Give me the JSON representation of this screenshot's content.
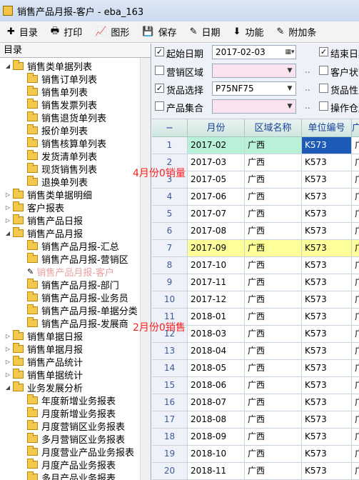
{
  "window": {
    "title": "销售产品月报-客户 - eba_163"
  },
  "toolbar": {
    "items": [
      {
        "label": "目录",
        "icon": "plus-icon"
      },
      {
        "label": "打印",
        "icon": "printer-icon"
      },
      {
        "label": "图形",
        "icon": "chart-icon"
      },
      {
        "label": "保存",
        "icon": "save-icon"
      },
      {
        "label": "日期",
        "icon": "wand-icon"
      },
      {
        "label": "功能",
        "icon": "down-arrow-icon"
      },
      {
        "label": "附加条",
        "icon": "wand-icon"
      }
    ]
  },
  "tree": {
    "header": "目录",
    "items": [
      {
        "label": "销售类单据列表",
        "level": 0,
        "expanded": true
      },
      {
        "label": "销售订单列表",
        "level": 1
      },
      {
        "label": "销售单列表",
        "level": 1
      },
      {
        "label": "销售发票列表",
        "level": 1
      },
      {
        "label": "销售退货单列表",
        "level": 1
      },
      {
        "label": "报价单列表",
        "level": 1
      },
      {
        "label": "销售核算单列表",
        "level": 1
      },
      {
        "label": "发货清单列表",
        "level": 1
      },
      {
        "label": "现货销售列表",
        "level": 1
      },
      {
        "label": "退换单列表",
        "level": 1
      },
      {
        "label": "销售类单据明细",
        "level": 0,
        "expanded": false
      },
      {
        "label": "客户报表",
        "level": 0,
        "expanded": false
      },
      {
        "label": "销售产品日报",
        "level": 0,
        "expanded": false
      },
      {
        "label": "销售产品月报",
        "level": 0,
        "expanded": true
      },
      {
        "label": "销售产品月报-汇总",
        "level": 1
      },
      {
        "label": "销售产品月报-营销区",
        "level": 1
      },
      {
        "label": "销售产品月报-客户",
        "level": 1,
        "selected": true
      },
      {
        "label": "销售产品月报-部门",
        "level": 1
      },
      {
        "label": "销售产品月报-业务员",
        "level": 1
      },
      {
        "label": "销售产品月报-单据分类",
        "level": 1
      },
      {
        "label": "销售产品月报-发展商",
        "level": 1
      },
      {
        "label": "销售单据日报",
        "level": 0,
        "expanded": false
      },
      {
        "label": "销售单据月报",
        "level": 0,
        "expanded": false
      },
      {
        "label": "销售产品统计",
        "level": 0,
        "expanded": false
      },
      {
        "label": "销售单据统计",
        "level": 0,
        "expanded": false
      },
      {
        "label": "业务发展分析",
        "level": 0,
        "expanded": true
      },
      {
        "label": "年度新增业务报表",
        "level": 1
      },
      {
        "label": "月度新增业务报表",
        "level": 1
      },
      {
        "label": "月度营销区业务报表",
        "level": 1
      },
      {
        "label": "多月营销区业务报表",
        "level": 1
      },
      {
        "label": "月度营业产品业务报表",
        "level": 1
      },
      {
        "label": "月度产品业务报表",
        "level": 1
      },
      {
        "label": "多月产品业务报表",
        "level": 1
      }
    ]
  },
  "filters": {
    "start_date": {
      "label": "起始日期",
      "checked": true,
      "value": "2017-02-03"
    },
    "end_date": {
      "label": "结束日期",
      "checked": true
    },
    "sales_area": {
      "label": "营销区域",
      "checked": false,
      "value": ""
    },
    "customer_status": {
      "label": "客户状态",
      "checked": false
    },
    "product_select": {
      "label": "货品选择",
      "checked": true,
      "value": "P75NF75"
    },
    "product_attr": {
      "label": "货品性质",
      "checked": false
    },
    "product_set": {
      "label": "产品集合",
      "checked": false,
      "value": ""
    },
    "operation": {
      "label": "操作仓库",
      "checked": false
    },
    "ellipsis": ".."
  },
  "grid": {
    "columns": [
      "−",
      "月份",
      "区域名称",
      "单位编号",
      "广"
    ],
    "rows": [
      {
        "n": "1",
        "month": "2017-02",
        "area": "广西",
        "code": "K573",
        "extra": "广"
      },
      {
        "n": "2",
        "month": "2017-03",
        "area": "广西",
        "code": "K573",
        "extra": "广"
      },
      {
        "n": "3",
        "month": "2017-05",
        "area": "广西",
        "code": "K573",
        "extra": "广"
      },
      {
        "n": "4",
        "month": "2017-06",
        "area": "广西",
        "code": "K573",
        "extra": "广"
      },
      {
        "n": "5",
        "month": "2017-07",
        "area": "广西",
        "code": "K573",
        "extra": "广"
      },
      {
        "n": "6",
        "month": "2017-08",
        "area": "广西",
        "code": "K573",
        "extra": "广"
      },
      {
        "n": "7",
        "month": "2017-09",
        "area": "广西",
        "code": "K573",
        "extra": "广"
      },
      {
        "n": "8",
        "month": "2017-10",
        "area": "广西",
        "code": "K573",
        "extra": "广"
      },
      {
        "n": "9",
        "month": "2017-11",
        "area": "广西",
        "code": "K573",
        "extra": "广"
      },
      {
        "n": "10",
        "month": "2017-12",
        "area": "广西",
        "code": "K573",
        "extra": "广"
      },
      {
        "n": "11",
        "month": "2018-01",
        "area": "广西",
        "code": "K573",
        "extra": "广"
      },
      {
        "n": "12",
        "month": "2018-03",
        "area": "广西",
        "code": "K573",
        "extra": "广"
      },
      {
        "n": "13",
        "month": "2018-04",
        "area": "广西",
        "code": "K573",
        "extra": "广"
      },
      {
        "n": "14",
        "month": "2018-05",
        "area": "广西",
        "code": "K573",
        "extra": "广"
      },
      {
        "n": "15",
        "month": "2018-06",
        "area": "广西",
        "code": "K573",
        "extra": "广"
      },
      {
        "n": "16",
        "month": "2018-07",
        "area": "广西",
        "code": "K573",
        "extra": "广"
      },
      {
        "n": "17",
        "month": "2018-08",
        "area": "广西",
        "code": "K573",
        "extra": "广"
      },
      {
        "n": "18",
        "month": "2018-09",
        "area": "广西",
        "code": "K573",
        "extra": "广"
      },
      {
        "n": "19",
        "month": "2018-10",
        "area": "广西",
        "code": "K573",
        "extra": "广"
      },
      {
        "n": "20",
        "month": "2018-11",
        "area": "广西",
        "code": "K573",
        "extra": "广"
      }
    ],
    "selected_row": 1,
    "highlight_row": 7
  },
  "annotations": [
    "4月份0销量",
    "2月份0销售"
  ],
  "colors": {
    "selected_row": "#b8f0d8",
    "highlight_row": "#ffff99",
    "annotation": "#ff2020",
    "code_selected_bg": "#1e5bb8"
  }
}
